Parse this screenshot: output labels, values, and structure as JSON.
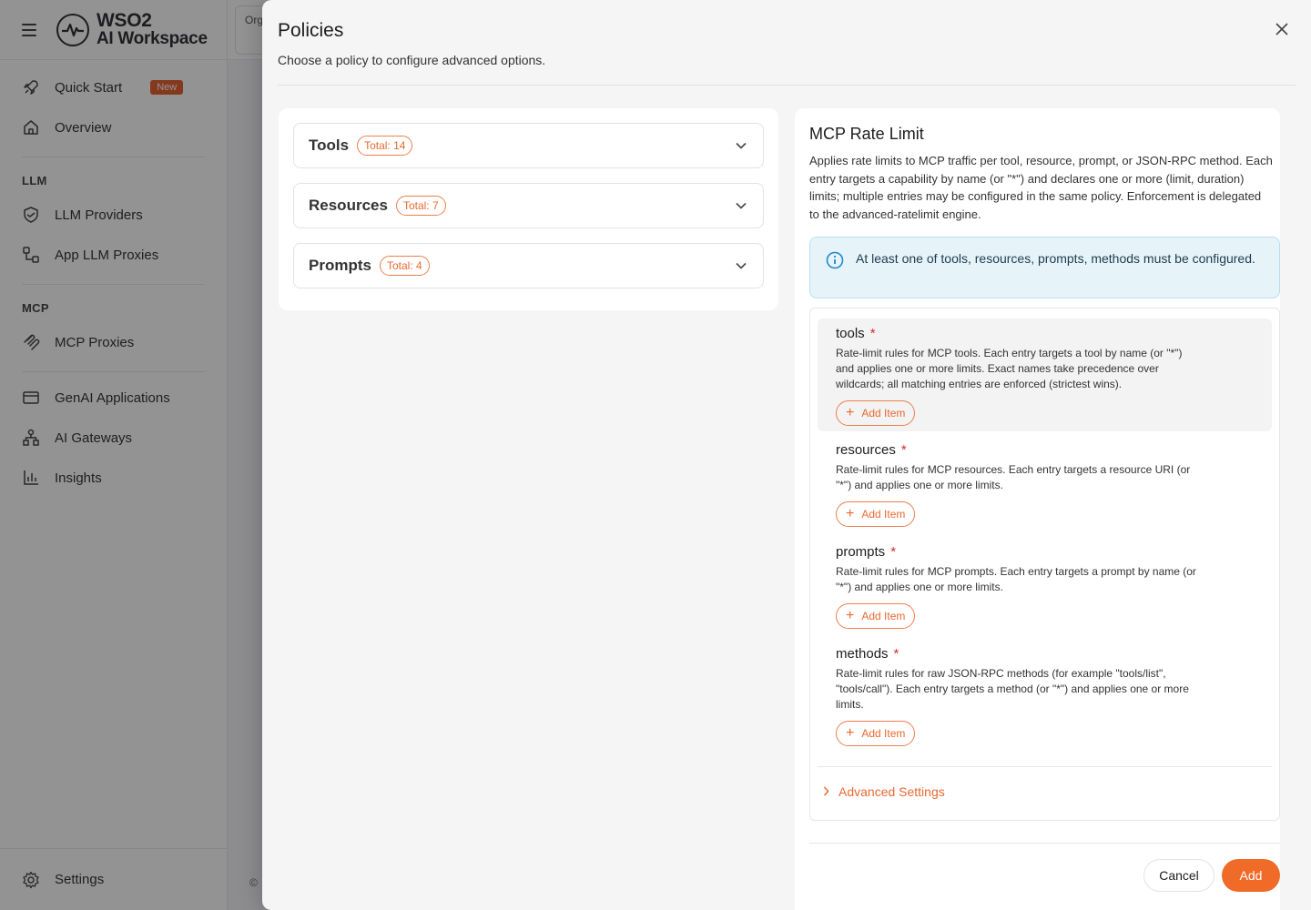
{
  "app": {
    "logo_line1": "WSO2",
    "logo_line2": "AI Workspace",
    "org_label": "Org"
  },
  "sidebar": {
    "items_top": [
      {
        "label": "Quick Start",
        "badge": "New",
        "icon": "rocket-icon"
      },
      {
        "label": "Overview",
        "icon": "home-icon"
      }
    ],
    "section_llm": "LLM",
    "items_llm": [
      {
        "label": "LLM Providers",
        "icon": "shield-handshake-icon"
      },
      {
        "label": "App LLM Proxies",
        "icon": "proxy-icon"
      }
    ],
    "section_mcp": "MCP",
    "items_mcp": [
      {
        "label": "MCP Proxies",
        "icon": "mcp-icon"
      }
    ],
    "items_bottom": [
      {
        "label": "GenAI Applications",
        "icon": "card-icon"
      },
      {
        "label": "AI Gateways",
        "icon": "hierarchy-icon"
      },
      {
        "label": "Insights",
        "icon": "bar-chart-icon"
      }
    ],
    "settings_label": "Settings"
  },
  "background": {
    "footer": "© "
  },
  "drawer": {
    "title": "Policies",
    "subtitle": "Choose a policy to configure advanced options.",
    "categories": [
      {
        "label": "Tools",
        "total": "Total: 14"
      },
      {
        "label": "Resources",
        "total": "Total: 7"
      },
      {
        "label": "Prompts",
        "total": "Total: 4"
      }
    ],
    "policy": {
      "title": "MCP Rate Limit",
      "description": "Applies rate limits to MCP traffic per tool, resource, prompt, or JSON-RPC method. Each entry targets a capability by name (or \"*\") and declares one or more (limit, duration) limits; multiple entries may be configured in the same policy. Enforcement is delegated to the advanced-ratelimit engine.",
      "info": "At least one of tools, resources, prompts, methods must be configured.",
      "fields": [
        {
          "name": "tools",
          "required": "*",
          "help": "Rate-limit rules for MCP tools. Each entry targets a tool by name (or \"*\") and applies one or more limits. Exact names take precedence over wildcards; all matching entries are enforced (strictest wins).",
          "add": "Add Item"
        },
        {
          "name": "resources",
          "required": "*",
          "help": "Rate-limit rules for MCP resources. Each entry targets a resource URI (or \"*\") and applies one or more limits.",
          "add": "Add Item"
        },
        {
          "name": "prompts",
          "required": "*",
          "help": "Rate-limit rules for MCP prompts. Each entry targets a prompt by name (or \"*\") and applies one or more limits.",
          "add": "Add Item"
        },
        {
          "name": "methods",
          "required": "*",
          "help": "Rate-limit rules for raw JSON-RPC methods (for example \"tools/list\", \"tools/call\"). Each entry targets a method (or \"*\") and applies one or more limits.",
          "add": "Add Item"
        }
      ],
      "advanced": "Advanced Settings",
      "cancel": "Cancel",
      "add": "Add"
    }
  },
  "colors": {
    "accent": "#f06a28",
    "accent_text": "#e8692f",
    "info_bg": "#e6f4fa",
    "info_border": "#b6dfef"
  }
}
